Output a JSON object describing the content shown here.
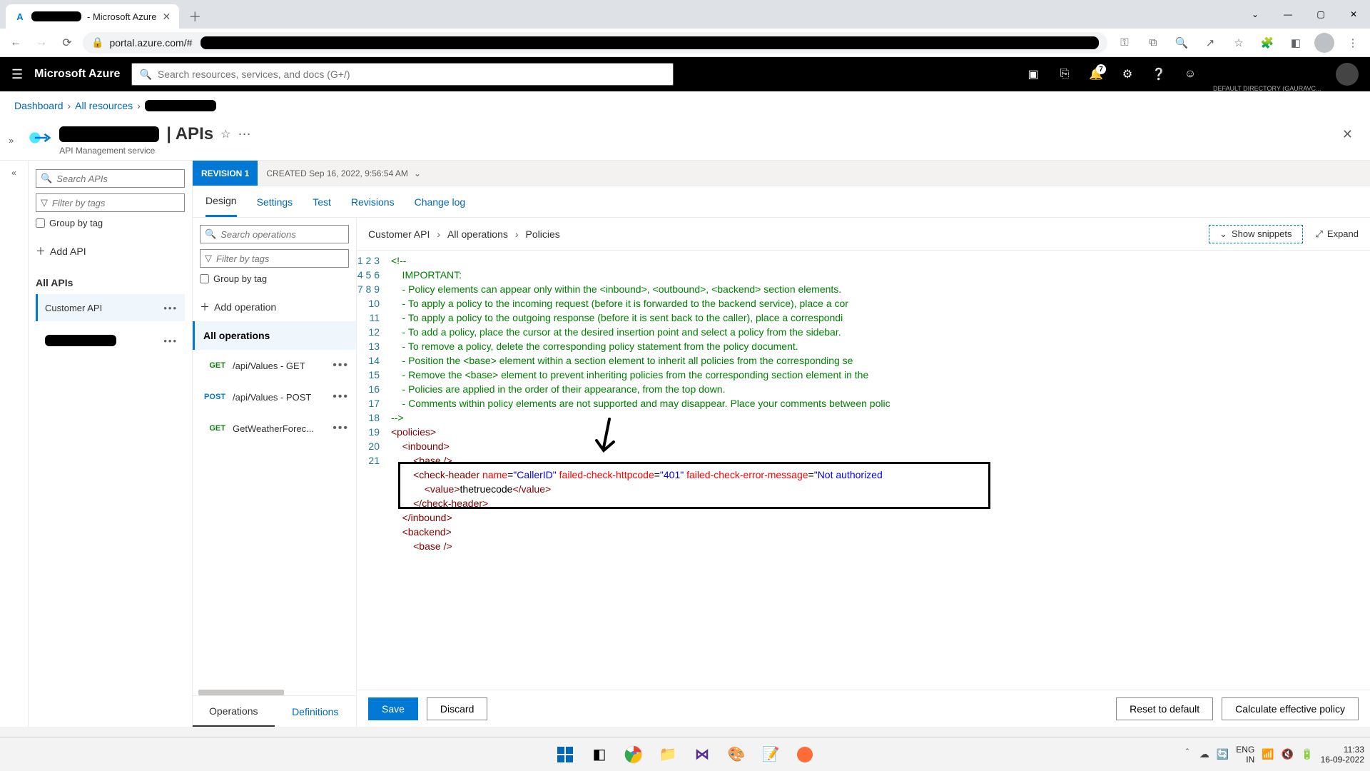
{
  "browser": {
    "tab_title_suffix": "- Microsoft Azure",
    "url_prefix": "portal.azure.com/#"
  },
  "azure": {
    "brand": "Microsoft Azure",
    "search_placeholder": "Search resources, services, and docs (G+/)",
    "notif_badge": "7",
    "directory_sub": "DEFAULT DIRECTORY (GAURAVC...",
    "breadcrumb": {
      "dashboard": "Dashboard",
      "all_resources": "All resources"
    },
    "page_title_suffix": "| APIs",
    "page_subtitle": "API Management service"
  },
  "api_col": {
    "search_placeholder": "Search APIs",
    "filter_placeholder": "Filter by tags",
    "group_by_tag": "Group by tag",
    "add_api": "Add API",
    "all_apis": "All APIs",
    "selected_api": "Customer API"
  },
  "revision": {
    "label": "REVISION 1",
    "created_prefix": "CREATED",
    "created_value": "Sep 16, 2022, 9:56:54 AM"
  },
  "tabs": {
    "design": "Design",
    "settings": "Settings",
    "test": "Test",
    "revisions": "Revisions",
    "changelog": "Change log"
  },
  "ops_col": {
    "search_placeholder": "Search operations",
    "filter_placeholder": "Filter by tags",
    "group_by_tag": "Group by tag",
    "add_operation": "Add operation",
    "all_operations": "All operations",
    "ops": [
      {
        "method": "GET",
        "name": "/api/Values - GET"
      },
      {
        "method": "POST",
        "name": "/api/Values - POST"
      },
      {
        "method": "GET",
        "name": "GetWeatherForec..."
      }
    ],
    "bottom_tabs": {
      "operations": "Operations",
      "definitions": "Definitions"
    }
  },
  "editor_crumb": {
    "a": "Customer API",
    "b": "All operations",
    "c": "Policies"
  },
  "editor_actions": {
    "snippets": "Show snippets",
    "expand": "Expand"
  },
  "code": {
    "lines": 21
  },
  "footer": {
    "save": "Save",
    "discard": "Discard",
    "reset": "Reset to default",
    "calc": "Calculate effective policy"
  },
  "taskbar": {
    "lang": "ENG",
    "kbd": "IN",
    "time": "11:33",
    "date": "16-09-2022"
  }
}
